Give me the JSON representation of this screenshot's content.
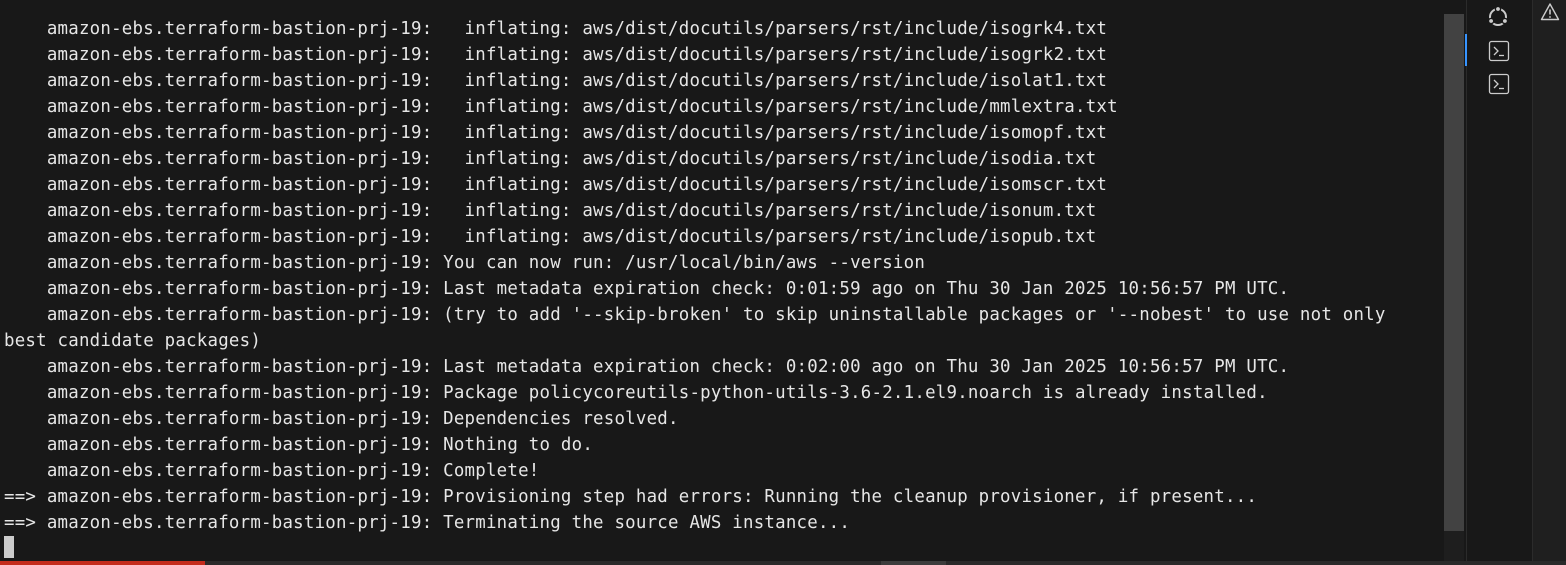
{
  "terminal": {
    "lines": [
      "    amazon-ebs.terraform-bastion-prj-19:   inflating: aws/dist/docutils/parsers/rst/include/isogrk4.txt",
      "    amazon-ebs.terraform-bastion-prj-19:   inflating: aws/dist/docutils/parsers/rst/include/isogrk2.txt",
      "    amazon-ebs.terraform-bastion-prj-19:   inflating: aws/dist/docutils/parsers/rst/include/isolat1.txt",
      "    amazon-ebs.terraform-bastion-prj-19:   inflating: aws/dist/docutils/parsers/rst/include/mmlextra.txt",
      "    amazon-ebs.terraform-bastion-prj-19:   inflating: aws/dist/docutils/parsers/rst/include/isomopf.txt",
      "    amazon-ebs.terraform-bastion-prj-19:   inflating: aws/dist/docutils/parsers/rst/include/isodia.txt",
      "    amazon-ebs.terraform-bastion-prj-19:   inflating: aws/dist/docutils/parsers/rst/include/isomscr.txt",
      "    amazon-ebs.terraform-bastion-prj-19:   inflating: aws/dist/docutils/parsers/rst/include/isonum.txt",
      "    amazon-ebs.terraform-bastion-prj-19:   inflating: aws/dist/docutils/parsers/rst/include/isopub.txt",
      "    amazon-ebs.terraform-bastion-prj-19: You can now run: /usr/local/bin/aws --version",
      "    amazon-ebs.terraform-bastion-prj-19: Last metadata expiration check: 0:01:59 ago on Thu 30 Jan 2025 10:56:57 PM UTC.",
      "    amazon-ebs.terraform-bastion-prj-19: (try to add '--skip-broken' to skip uninstallable packages or '--nobest' to use not only",
      "best candidate packages)",
      "    amazon-ebs.terraform-bastion-prj-19: Last metadata expiration check: 0:02:00 ago on Thu 30 Jan 2025 10:56:57 PM UTC.",
      "    amazon-ebs.terraform-bastion-prj-19: Package policycoreutils-python-utils-3.6-2.1.el9.noarch is already installed.",
      "    amazon-ebs.terraform-bastion-prj-19: Dependencies resolved.",
      "    amazon-ebs.terraform-bastion-prj-19: Nothing to do.",
      "    amazon-ebs.terraform-bastion-prj-19: Complete!",
      "==> amazon-ebs.terraform-bastion-prj-19: Provisioning step had errors: Running the cleanup provisioner, if present...",
      "==> amazon-ebs.terraform-bastion-prj-19: Terminating the source AWS instance..."
    ]
  },
  "side_panel": {
    "icons": [
      "ubuntu-icon",
      "terminal-icon",
      "terminal-icon"
    ]
  },
  "status": {
    "warning_icon": "warning-icon"
  },
  "colors": {
    "background": "#181818",
    "text": "#e6e6e6",
    "active_accent": "#3794ff",
    "error_accent": "#c42b1c"
  }
}
